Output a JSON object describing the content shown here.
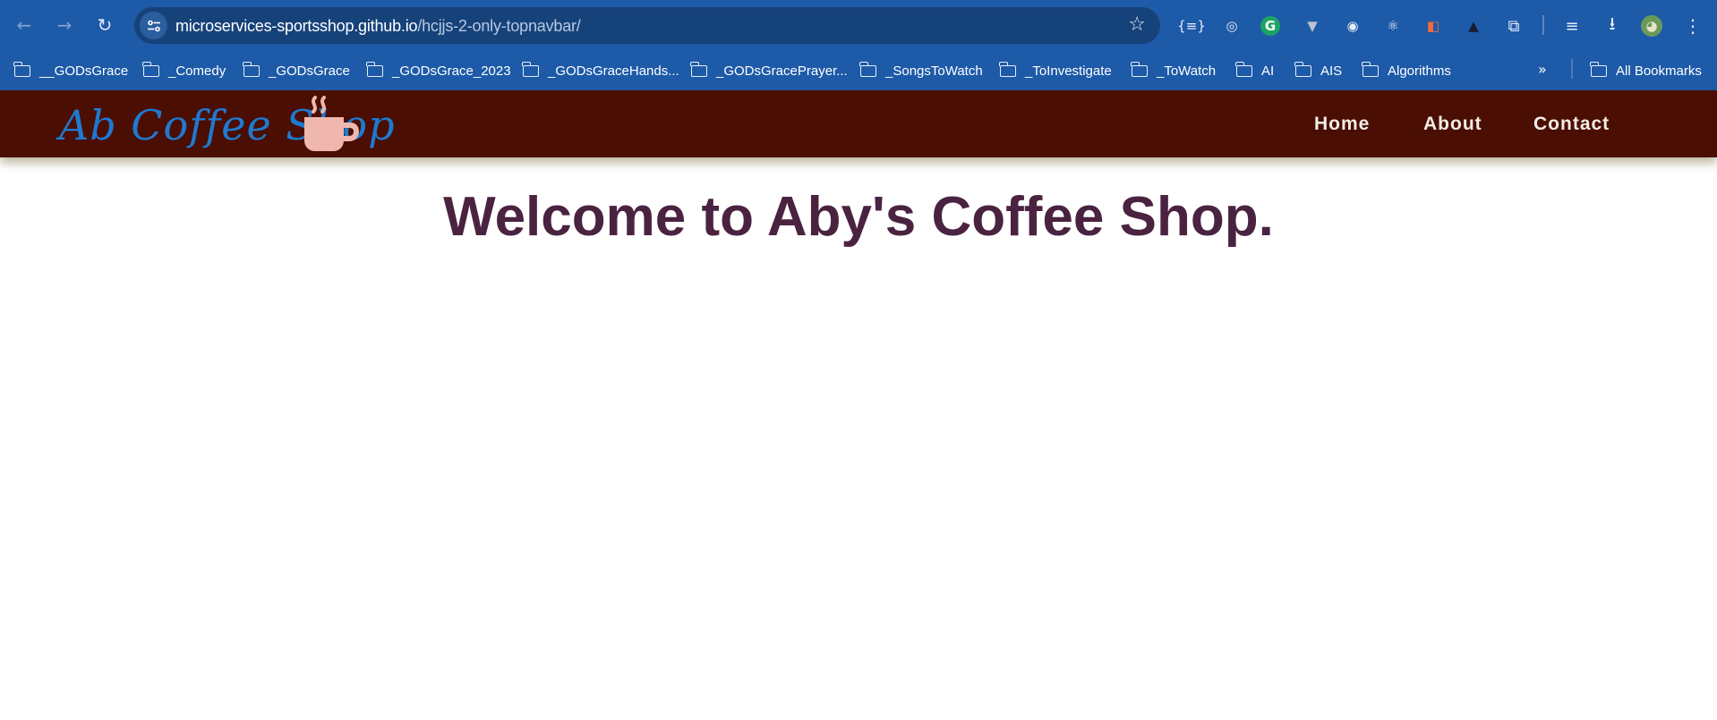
{
  "browser": {
    "back_icon": "←",
    "forward_icon": "→",
    "reload_icon": "↻",
    "url_domain": "microservices-sportsshop.github.io",
    "url_path": "/hcjjs-2-only-topnavbar/",
    "star_icon": "☆"
  },
  "extensions": [
    {
      "name": "braces-icon",
      "glyph": "{≡}"
    },
    {
      "name": "circle-ext-icon",
      "glyph": "◎"
    },
    {
      "name": "grammarly-icon",
      "glyph": "G"
    },
    {
      "name": "vue-icon",
      "glyph": "▼"
    },
    {
      "name": "target-icon",
      "glyph": "◉"
    },
    {
      "name": "react-icon",
      "glyph": "⚛"
    },
    {
      "name": "flag-ext-icon",
      "glyph": "◧"
    },
    {
      "name": "angular-icon",
      "glyph": "▲"
    },
    {
      "name": "puzzle-icon",
      "glyph": "⧉"
    },
    {
      "name": "media-queue-icon",
      "glyph": "≡"
    },
    {
      "name": "download-icon",
      "glyph": "⭳"
    },
    {
      "name": "profile-avatar-icon",
      "glyph": "◕"
    },
    {
      "name": "kebab-menu-icon",
      "glyph": "⋮"
    }
  ],
  "bookmarks": [
    "__GODsGrace",
    "_Comedy",
    "_GODsGrace",
    "_GODsGrace_2023",
    "_GODsGraceHands...",
    "_GODsGracePrayer...",
    "_SongsToWatch",
    "_ToInvestigate",
    "_ToWatch",
    "AI",
    "AIS",
    "Algorithms"
  ],
  "bookmarks_more_icon": "»",
  "all_bookmarks_label": "All Bookmarks",
  "page": {
    "logo_text": "Ab Coffee Shop",
    "nav": {
      "home": "Home",
      "about": "About",
      "contact": "Contact"
    },
    "headline": "Welcome to Aby's Coffee Shop.",
    "colors": {
      "navbar_bg": "#4a0e03",
      "logo_text": "#1f7ad0",
      "cup": "#efb7ad",
      "headline": "#4a2340",
      "chrome_bg": "#1d5aa8"
    }
  }
}
